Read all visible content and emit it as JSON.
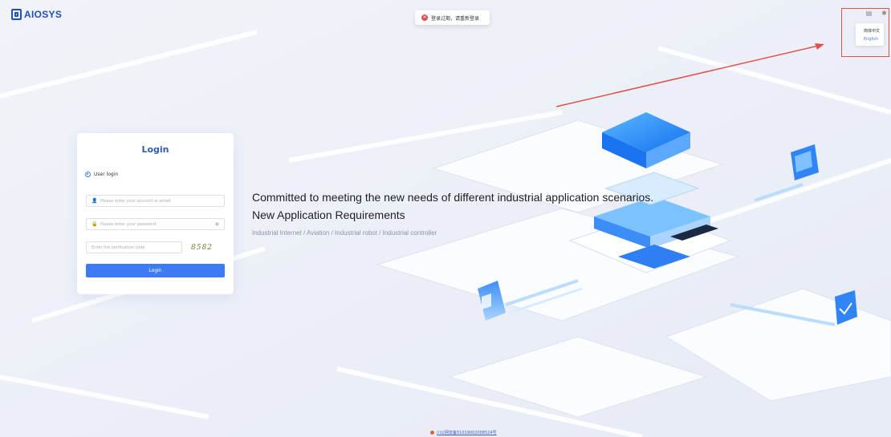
{
  "brand": {
    "logo_text": "AIOSYS"
  },
  "toast": {
    "icon": "error-icon",
    "message": "登录过期，请重新登录"
  },
  "top_bar": {
    "icons": [
      "document-icon",
      "gear-icon"
    ]
  },
  "language_menu": {
    "items": [
      "简体中文",
      "English"
    ],
    "active": "English",
    "active_color": "#3d7bf5"
  },
  "login": {
    "title": "Login",
    "mode_label": "User login",
    "account_placeholder": "Please enter your account or email",
    "password_placeholder": "Please enter your password",
    "captcha_placeholder": "Enter the verification code",
    "captcha_text": "8582",
    "button_label": "Login"
  },
  "hero": {
    "headline": "Committed to meeting the new needs of different industrial application scenarios.",
    "subheadline": "New Application Requirements",
    "tagline": "Industrial Internet / Aviation / Industrial robot / Industrial controller"
  },
  "footer": {
    "text": "川公网安备51019002008524号"
  },
  "colors": {
    "primary": "#3d7bf5",
    "title": "#2e5fa8",
    "annotation": "#e0524c",
    "error": "#e94b4b"
  }
}
